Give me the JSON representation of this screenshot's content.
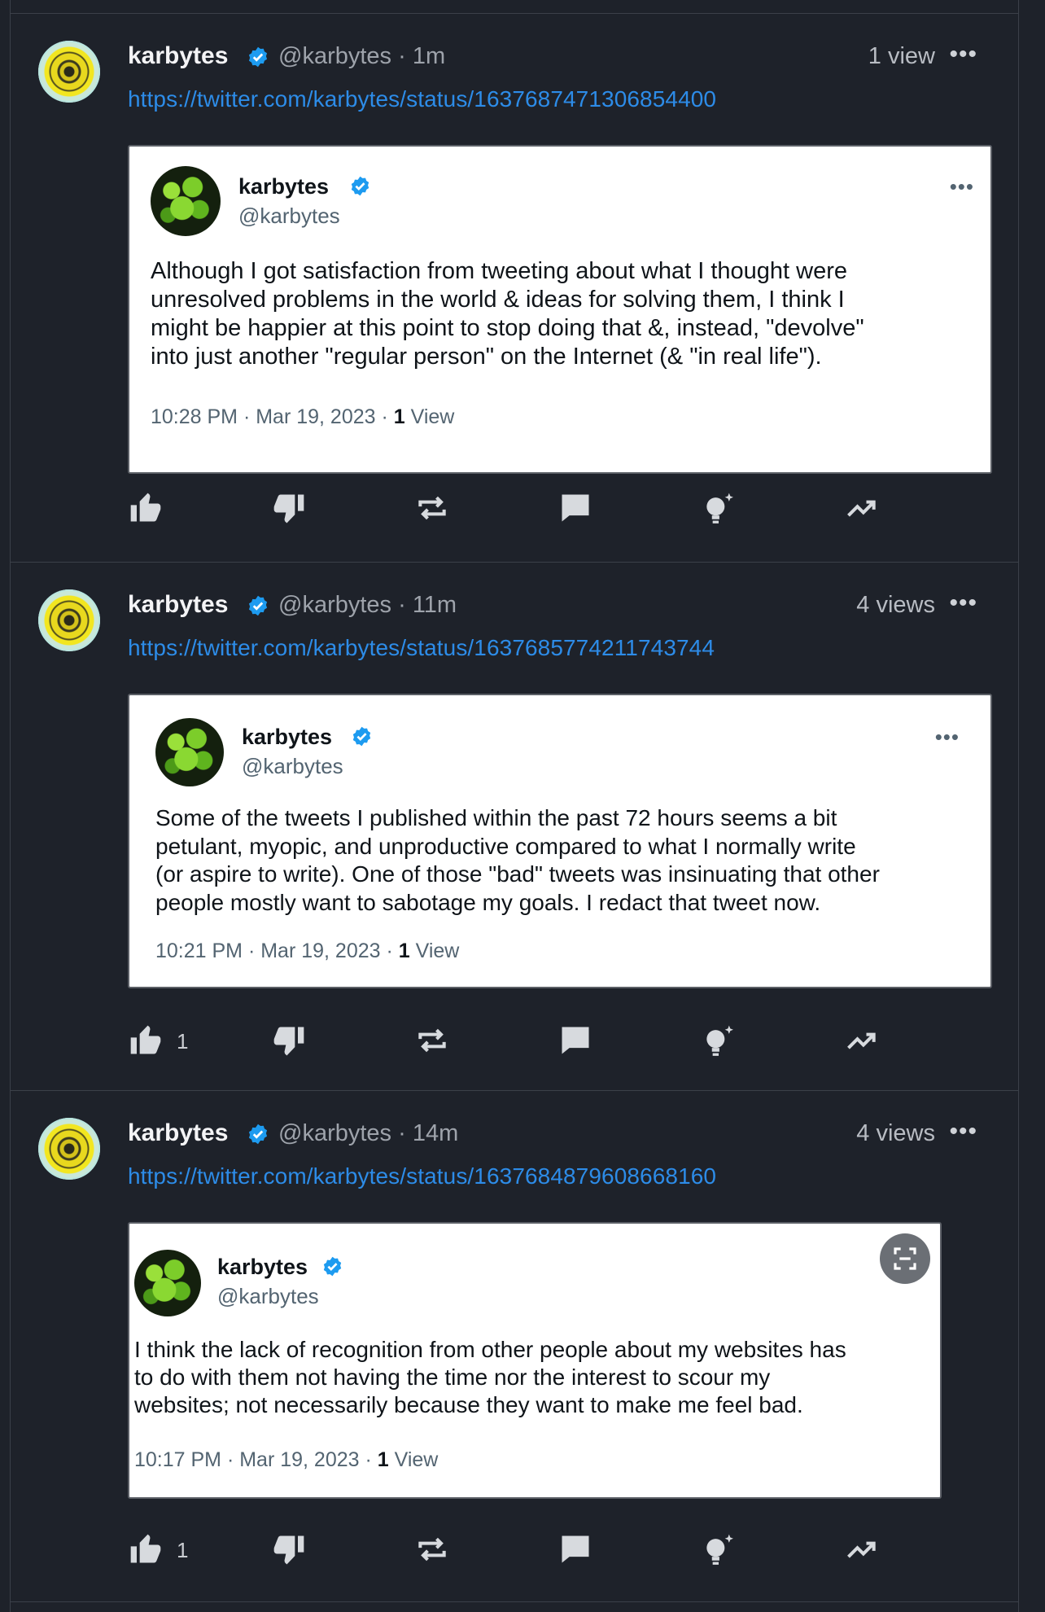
{
  "posts": [
    {
      "author": "karbytes",
      "handle": "@karbytes",
      "time": "· 1m",
      "views": "1 view",
      "more": "•••",
      "link": "https://twitter.com/karbytes/status/1637687471306854400",
      "card": {
        "name": "karbytes",
        "handle": "@karbytes",
        "more": "•••",
        "text": "Although I got satisfaction from tweeting about what I thought were\nunresolved problems in the world & ideas for solving them, I think I\nmight be happier at this point to stop doing that &, instead, \"devolve\"\ninto just another \"regular person\" on the Internet (& \"in real life\").",
        "timestamp": "10:28 PM · Mar 19, 2023 · ",
        "view_count": "1",
        "view_label": " View"
      },
      "likes": ""
    },
    {
      "author": "karbytes",
      "handle": "@karbytes",
      "time": "· 11m",
      "views": "4 views",
      "more": "•••",
      "link": "https://twitter.com/karbytes/status/1637685774211743744",
      "card": {
        "name": "karbytes",
        "handle": "@karbytes",
        "more": "•••",
        "text": "Some of the tweets I published within the past 72 hours seems a bit\npetulant, myopic, and unproductive compared to what I normally write\n(or aspire to write). One of those \"bad\" tweets was insinuating that other\npeople mostly want to sabotage my goals. I redact that tweet now.",
        "timestamp": "10:21 PM · Mar 19, 2023 · ",
        "view_count": "1",
        "view_label": " View"
      },
      "likes": "1"
    },
    {
      "author": "karbytes",
      "handle": "@karbytes",
      "time": "· 14m",
      "views": "4 views",
      "more": "•••",
      "link": "https://twitter.com/karbytes/status/1637684879608668160",
      "card": {
        "name": "karbytes",
        "handle": "@karbytes",
        "more": "",
        "text": "I think the lack of recognition from other people about my websites has\nto do with them not having the time nor the interest to scour my\nwebsites; not necessarily because they want to make me feel bad.",
        "timestamp": "10:17 PM · Mar 19, 2023 · ",
        "view_count": "1",
        "view_label": " View"
      },
      "likes": "1"
    }
  ],
  "icons": {
    "verified": "verified-badge-icon",
    "like": "thumbs-up-icon",
    "dislike": "thumbs-down-icon",
    "repost": "repost-icon",
    "comment": "comment-icon",
    "insight": "lightbulb-icon",
    "analytics": "trending-icon",
    "scan": "scan-icon"
  },
  "colors": {
    "background": "#1e222a",
    "link": "#2d8ce8",
    "verified": "#1d9bf0",
    "card_bg": "#ffffff"
  }
}
